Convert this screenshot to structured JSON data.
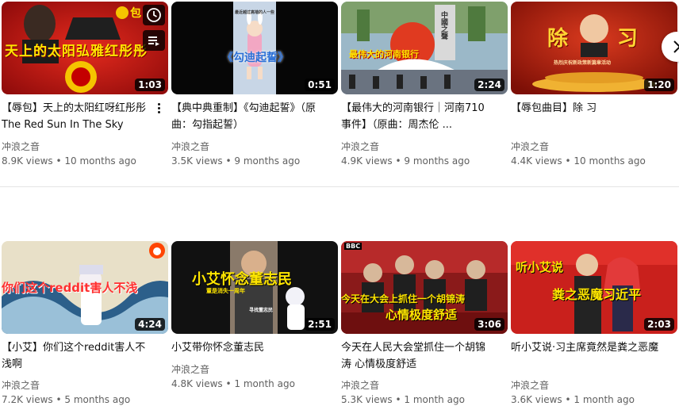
{
  "videos": [
    {
      "title": "【辱包】天上的太阳红呀红彤彤 The Red Sun In The Sky",
      "channel": "冲浪之音",
      "views": "8.9K views",
      "age": "10 months ago",
      "duration": "1:03",
      "thumb_text": "天上的太阳弘雅红彤彤",
      "thumb_badge": "包"
    },
    {
      "title": "【典中典重制】《勾迪起誓》（原曲：勾指起誓）",
      "channel": "冲浪之音",
      "views": "3.5K views",
      "age": "9 months ago",
      "duration": "0:51",
      "thumb_text": "《勾迪起誓》",
      "thumb_small": "最近越过高墙的人一些"
    },
    {
      "title": "【最伟大的河南银行｜河南710事件】（原曲：周杰伦 ...",
      "channel": "冲浪之音",
      "views": "4.9K views",
      "age": "9 months ago",
      "duration": "2:24",
      "thumb_text": "最伟大的河南银行",
      "thumb_sign": "中國之聲"
    },
    {
      "title": "【辱包曲目】除 习",
      "channel": "冲浪之音",
      "views": "4.4K views",
      "age": "10 months ago",
      "duration": "1:20",
      "thumb_text_left": "除",
      "thumb_text_right": "习",
      "thumb_small": "热烈庆祝新政策新篇章活动"
    },
    {
      "title": "【小艾】你们这个reddit害人不浅啊",
      "channel": "冲浪之音",
      "views": "7.2K views",
      "age": "5 months ago",
      "duration": "4:24",
      "thumb_text": "你们这个reddit害人不浅"
    },
    {
      "title": "小艾带你怀念董志民",
      "channel": "冲浪之音",
      "views": "4.8K views",
      "age": "1 month ago",
      "duration": "2:51",
      "thumb_text": "小艾怀念董志民",
      "thumb_small": "董是消失一周年",
      "thumb_small2": "寻找董志民"
    },
    {
      "title": "今天在人民大会堂抓住一个胡锦涛 心情极度舒适",
      "channel": "冲浪之音",
      "views": "5.3K views",
      "age": "1 month ago",
      "duration": "3:06",
      "thumb_text": "今天在大会上抓住一个胡锦涛",
      "thumb_text2": "心情极度舒适",
      "thumb_logo": "BBC"
    },
    {
      "title": "听小艾说·习主席竟然是粪之恶魔",
      "channel": "冲浪之音",
      "views": "3.6K views",
      "age": "1 month ago",
      "duration": "2:03",
      "thumb_text": "听小艾说",
      "thumb_text2": "粪之恶魔习近平"
    }
  ],
  "separator": "•",
  "icons": [
    "clock-icon",
    "queue-icon",
    "more-vert-icon",
    "chevron-right-icon"
  ],
  "colors": {
    "duration_bg": "#000000",
    "meta_text": "#606060",
    "title_text": "#0f0f0f"
  }
}
